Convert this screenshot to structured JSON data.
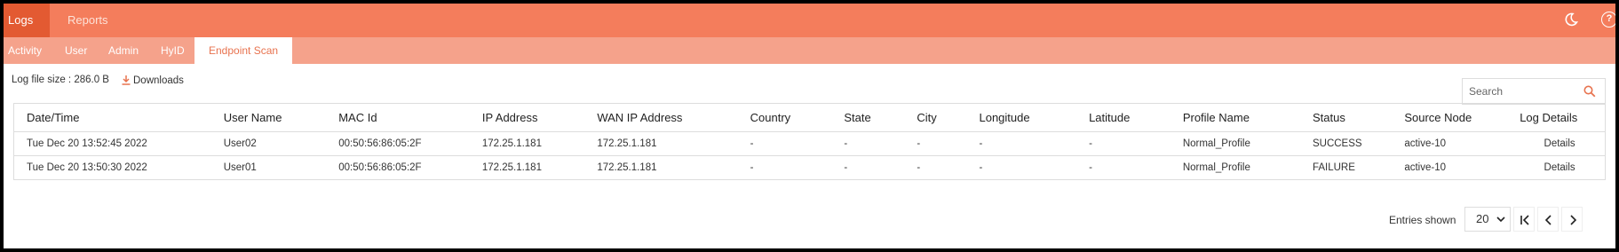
{
  "topbar": {
    "tabs": [
      {
        "label": "Logs",
        "active": true
      },
      {
        "label": "Reports"
      }
    ],
    "icons": [
      "moon-icon",
      "help-icon"
    ],
    "help_glyph": "?"
  },
  "subtabs": [
    {
      "label": "Activity"
    },
    {
      "label": "User"
    },
    {
      "label": "Admin"
    },
    {
      "label": "HyID"
    },
    {
      "label": "Endpoint Scan",
      "active": true
    }
  ],
  "toolbar": {
    "log_file_size": "Log file size : 286.0 B",
    "downloads_label": "Downloads"
  },
  "search": {
    "placeholder": "Search"
  },
  "table": {
    "headers": [
      "Date/Time",
      "User Name",
      "MAC Id",
      "IP Address",
      "WAN IP Address",
      "Country",
      "State",
      "City",
      "Longitude",
      "Latitude",
      "Profile Name",
      "Status",
      "Source Node",
      "Log Details"
    ],
    "rows": [
      [
        "Tue Dec 20 13:52:45 2022",
        "User02",
        "00:50:56:86:05:2F",
        "172.25.1.181",
        "172.25.1.181",
        "-",
        "-",
        "-",
        "-",
        "-",
        "Normal_Profile",
        "SUCCESS",
        "active-10",
        "Details"
      ],
      [
        "Tue Dec 20 13:50:30 2022",
        "User01",
        "00:50:56:86:05:2F",
        "172.25.1.181",
        "172.25.1.181",
        "-",
        "-",
        "-",
        "-",
        "-",
        "Normal_Profile",
        "FAILURE",
        "active-10",
        "Details"
      ]
    ]
  },
  "pagination": {
    "entries_label": "Entries shown",
    "entries_value": "20"
  },
  "colors": {
    "topbar": "#f47d5c",
    "active_tab": "#e35a32",
    "subbar": "#f5a28b",
    "accent": "#e8734f"
  }
}
